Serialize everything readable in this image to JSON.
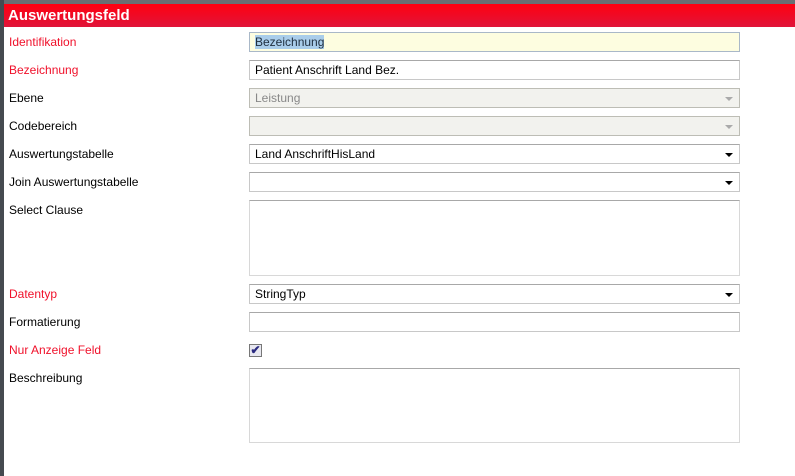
{
  "title": "Auswertungsfeld",
  "fields": {
    "identifikation": {
      "label": "Identifikation",
      "value": "Bezeichnung"
    },
    "bezeichnung": {
      "label": "Bezeichnung",
      "value": "Patient Anschrift Land Bez."
    },
    "ebene": {
      "label": "Ebene",
      "value": "Leistung"
    },
    "codebereich": {
      "label": "Codebereich",
      "value": ""
    },
    "auswertungstabelle": {
      "label": "Auswertungstabelle",
      "value": "Land AnschriftHisLand"
    },
    "join": {
      "label": "Join Auswertungstabelle",
      "value": ""
    },
    "select_clause": {
      "label": "Select Clause",
      "value": ""
    },
    "datentyp": {
      "label": "Datentyp",
      "value": "StringTyp"
    },
    "formatierung": {
      "label": "Formatierung",
      "value": ""
    },
    "nur_anzeige": {
      "label": "Nur Anzeige Feld",
      "checked": true
    },
    "beschreibung": {
      "label": "Beschreibung",
      "value": ""
    }
  }
}
